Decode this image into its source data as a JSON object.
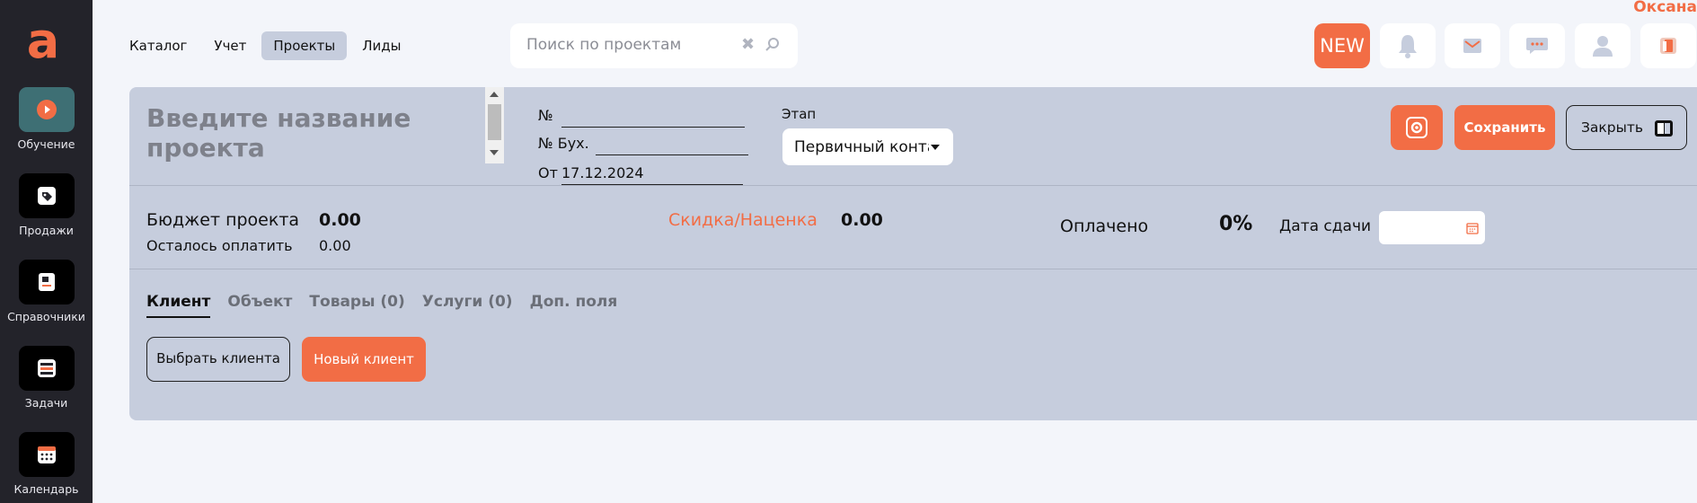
{
  "brand": {
    "logo_letter": "a",
    "accent": "#f26d45"
  },
  "sidebar": {
    "items": [
      {
        "label": "Обучение",
        "icon": "play-icon"
      },
      {
        "label": "Продажи",
        "icon": "tag-icon"
      },
      {
        "label": "Справочники",
        "icon": "book-icon"
      },
      {
        "label": "Задачи",
        "icon": "list-icon"
      },
      {
        "label": "Календарь",
        "icon": "calendar-icon"
      }
    ]
  },
  "topnav": {
    "links": [
      {
        "label": "Каталог"
      },
      {
        "label": "Учет"
      },
      {
        "label": "Проекты",
        "active": true
      },
      {
        "label": "Лиды"
      }
    ]
  },
  "search": {
    "placeholder": "Поиск по проектам",
    "value": "",
    "clear_glyph": "✖"
  },
  "header": {
    "user_name": "Оксана",
    "new_label": "NEW",
    "icons": [
      "bell-icon",
      "mail-icon",
      "chat-icon",
      "user-icon",
      "logout-icon"
    ]
  },
  "project": {
    "title_placeholder": "Введите название проекта",
    "number_label": "№",
    "number_value": "",
    "acc_number_label": "№ Бух.",
    "acc_number_value": "",
    "from_label": "От",
    "date": "17.12.2024",
    "stage_label": "Этап",
    "stage_value": "Первичный контакт"
  },
  "actions": {
    "save_label": "Сохранить",
    "close_label": "Закрыть"
  },
  "budget": {
    "budget_label": "Бюджет проекта",
    "budget_value": "0.00",
    "remaining_label": "Осталось оплатить",
    "remaining_value": "0.00",
    "discount_label": "Скидка/Наценка",
    "discount_value": "0.00",
    "paid_label": "Оплачено",
    "paid_value": "0%",
    "due_label": "Дата сдачи",
    "due_value": ""
  },
  "tabs": [
    {
      "label": "Клиент",
      "active": true
    },
    {
      "label": "Объект"
    },
    {
      "label": "Товары (0)"
    },
    {
      "label": "Услуги (0)"
    },
    {
      "label": "Доп. поля"
    }
  ],
  "client": {
    "choose_label": "Выбрать клиента",
    "new_label": "Новый клиент"
  }
}
